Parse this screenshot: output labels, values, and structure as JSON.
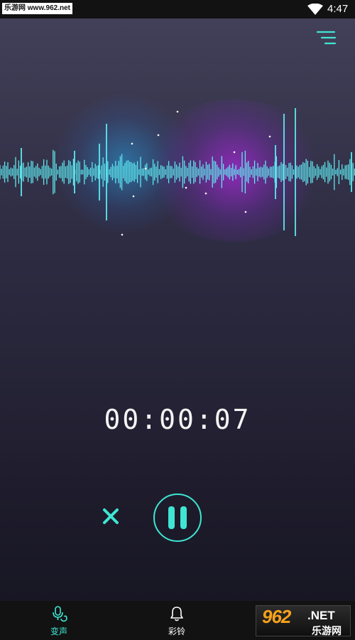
{
  "status_bar": {
    "watermark": "乐游网 www.962.net",
    "time": "4:47"
  },
  "colors": {
    "accent": "#3fe6d3",
    "waveform": "#5ee8ee",
    "glow_purple": "#a629d8",
    "glow_blue": "#2aa0e6"
  },
  "icons": {
    "menu": "menu-lines-icon",
    "cancel": "close-x-icon",
    "pause": "pause-icon",
    "voice": "microphone-swap-icon",
    "ringtone": "bell-icon",
    "wifi": "wifi-icon"
  },
  "recorder": {
    "timer": "00:00:07",
    "state": "recording"
  },
  "bottom_nav": {
    "items": [
      {
        "label": "变声",
        "active": true
      },
      {
        "label": "彩铃",
        "active": false
      }
    ]
  },
  "watermark_bottom": {
    "number": "962",
    "suffix": ".NET",
    "site": "乐游网"
  }
}
